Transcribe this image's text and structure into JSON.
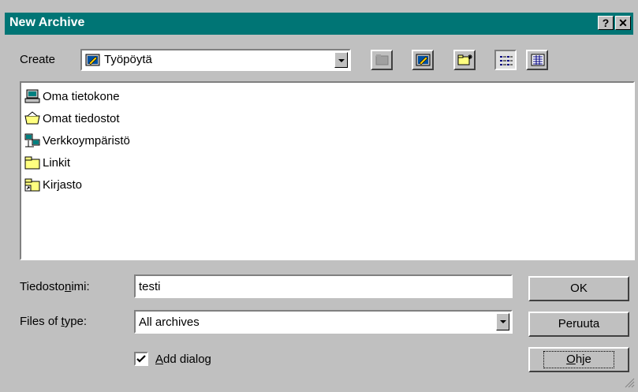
{
  "window": {
    "title": "New Archive",
    "help_glyph": "?",
    "close_glyph": "✕"
  },
  "create": {
    "label": "Create",
    "location": "Työpöytä"
  },
  "files": [
    {
      "name": "Oma tietokone",
      "icon": "computer-icon"
    },
    {
      "name": "Omat tiedostot",
      "icon": "my-documents-icon"
    },
    {
      "name": "Verkkoympäristö",
      "icon": "network-icon"
    },
    {
      "name": "Linkit",
      "icon": "folder-icon"
    },
    {
      "name": "Kirjasto",
      "icon": "folder-shortcut-icon"
    }
  ],
  "filename": {
    "label_pre": "Tiedosto",
    "label_u": "n",
    "label_post": "imi:",
    "value": "testi"
  },
  "filetype": {
    "label_pre": "Files of ",
    "label_u": "t",
    "label_post": "ype:",
    "value": "All archives"
  },
  "checkbox": {
    "label_u": "A",
    "label_post": "dd dialog",
    "checked": true
  },
  "buttons": {
    "ok": "OK",
    "cancel": "Peruuta",
    "help_u": "O",
    "help_post": "hje"
  }
}
